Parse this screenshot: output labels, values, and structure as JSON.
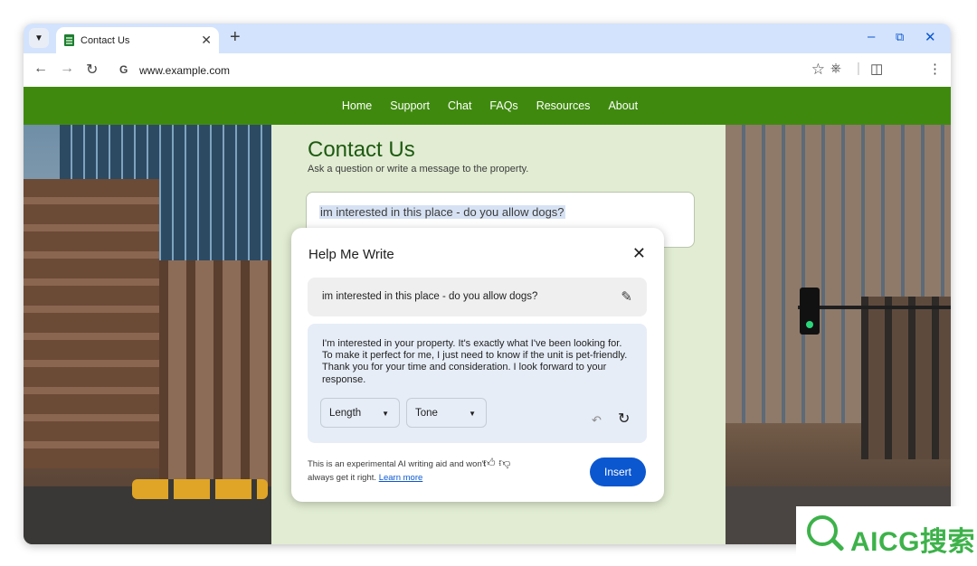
{
  "browser": {
    "tab_title": "Contact Us",
    "url": "www.example.com",
    "icons": {
      "tab_list": "chevron-down-icon",
      "tab_close": "close-icon",
      "new_tab": "plus-icon",
      "minimize": "minimize-icon",
      "restore": "restore-icon",
      "close": "close-icon",
      "back": "arrow-left-icon",
      "forward": "arrow-right-icon",
      "reload": "reload-icon",
      "site": "google-g-icon",
      "bookmark": "star-icon",
      "extensions": "puzzle-icon",
      "side_panel": "side-panel-icon",
      "profile": "avatar",
      "menu": "more-vert-icon"
    }
  },
  "site": {
    "nav": [
      "Home",
      "Support",
      "Chat",
      "FAQs",
      "Resources",
      "About"
    ],
    "colors": {
      "nav": "#3f8a0e",
      "center_bg": "#e1ecd2",
      "heading": "#1e5a12"
    },
    "page_title": "Contact Us",
    "page_subtitle": "Ask a question or write a message to the property.",
    "message_text": "im interested in this place - do you allow dogs?"
  },
  "dialog": {
    "title": "Help Me Write",
    "prompt": "im interested in this place - do you allow dogs?",
    "result": "I'm interested in your property. It's exactly what I've been looking for. To make it perfect for me, I just need to know if the unit is pet-friendly. Thank you for your time and consideration. I look forward to your response.",
    "length_label": "Length",
    "tone_label": "Tone",
    "footer_text": "This is an experimental AI writing aid and won't always get it right.",
    "learn_more": "Learn more",
    "insert_label": "Insert",
    "colors": {
      "insert": "#0b57d0",
      "result_bg": "#e6edf7"
    }
  },
  "watermark": {
    "text": "AICG搜索",
    "color": "#3db24a"
  }
}
